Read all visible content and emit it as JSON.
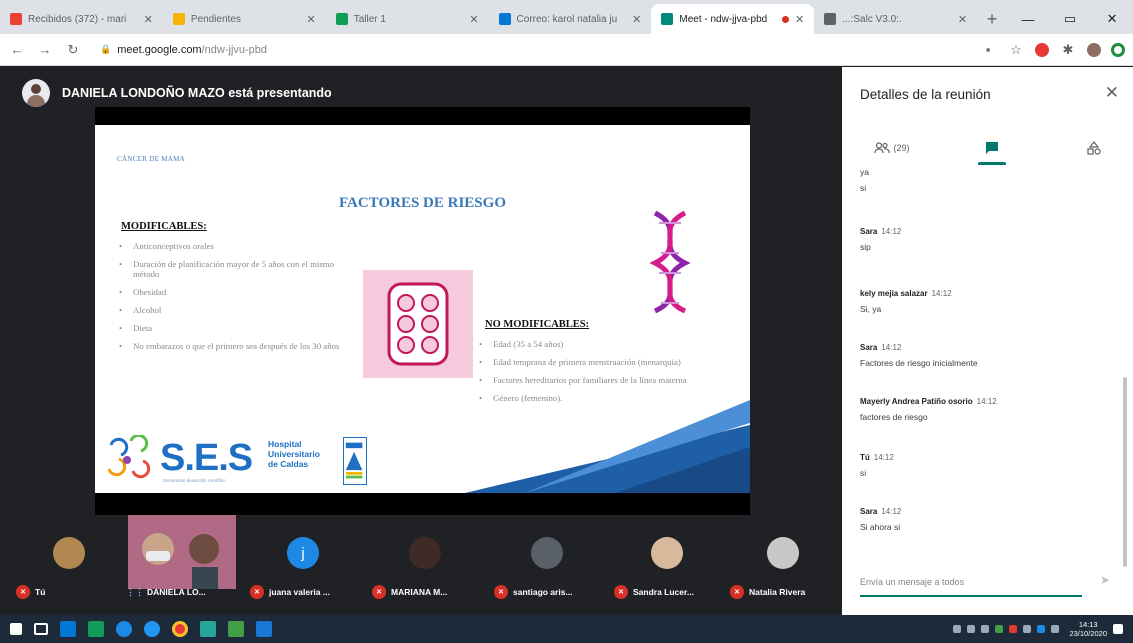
{
  "browser": {
    "tabs": [
      {
        "label": "Recibidos (372) - mari",
        "favicon_color": "#ea4335",
        "active": false
      },
      {
        "label": "Pendientes",
        "favicon_color": "#f4b400",
        "active": false
      },
      {
        "label": "Taller 1",
        "favicon_color": "#0f9d58",
        "active": false
      },
      {
        "label": "Correo: karol natalia ju",
        "favicon_color": "#0078d4",
        "active": false
      },
      {
        "label": "Meet - ndw-jjva-pbd",
        "favicon_color": "#00897b",
        "active": true
      },
      {
        "label": "...:Salc V3.0:.",
        "favicon_color": "#5f6368",
        "active": false
      }
    ],
    "new_tab": "+",
    "url_host": "meet.google.com",
    "url_path": "/ndw-jjvu-pbd"
  },
  "presenter": {
    "text": "DANIELA LONDOÑO MAZO está presentando"
  },
  "slide": {
    "topic": "CÁNCER DE MAMA",
    "title": "FACTORES DE RIESGO",
    "modifiable_heading": "MODIFICABLES:",
    "modifiable_items": [
      "Anticonceptivos orales",
      "Duración de planificación mayor de 5 años con el mismo método",
      "Obesidad",
      "Alcohol",
      "Dieta",
      "No embarazos o que el primero sea después de los 30 años"
    ],
    "non_modifiable_heading": "NO MODIFICABLES:",
    "non_modifiable_items": [
      "Edad (35 a 54 años)",
      "Edad temprana de primera menstruación (menarquia)",
      "Factores hereditarios por familiares de la línea materna",
      "Género (femenino)."
    ],
    "logo": {
      "name": "S.E.S",
      "hospital_line1": "Hospital",
      "hospital_line2": "Universitario",
      "hospital_line3": "de Caldas",
      "tagline": "Generando desarrollo científico"
    }
  },
  "panel": {
    "title": "Detalles de la reunión",
    "people_count": "(29)",
    "messages": [
      {
        "name": "",
        "time": "",
        "lines": [
          "ya",
          "si"
        ]
      },
      {
        "name": "Sara",
        "time": "14:12",
        "lines": [
          "sip"
        ]
      },
      {
        "name": "kely mejia salazar",
        "time": "14:12",
        "lines": [
          "Si, ya"
        ]
      },
      {
        "name": "Sara",
        "time": "14:12",
        "lines": [
          "Factores de riesgo inicialmente"
        ]
      },
      {
        "name": "Mayerly Andrea Patiño osorio",
        "time": "14:12",
        "lines": [
          "factores de riesgo"
        ]
      },
      {
        "name": "Tú",
        "time": "14:12",
        "lines": [
          "si"
        ]
      },
      {
        "name": "Sara",
        "time": "14:12",
        "lines": [
          "Si ahora si"
        ]
      }
    ],
    "composer_placeholder": "Envía un mensaje a todos"
  },
  "participants": [
    {
      "name": "Tú",
      "avatar_color": "#b08850",
      "muted": true,
      "kind": "photo"
    },
    {
      "name": "DANIELA LO...",
      "avatar_color": "#a65b7a",
      "muted": false,
      "kind": "video"
    },
    {
      "name": "juana valeria ...",
      "avatar_color": "#1e88e5",
      "muted": true,
      "kind": "letter",
      "letter": "j"
    },
    {
      "name": "MARIANA M...",
      "avatar_color": "#3e2b25",
      "muted": true,
      "kind": "photo"
    },
    {
      "name": "santiago aris...",
      "avatar_color": "#5a6068",
      "muted": true,
      "kind": "photo"
    },
    {
      "name": "Sandra Lucer...",
      "avatar_color": "#d9b99b",
      "muted": true,
      "kind": "photo"
    },
    {
      "name": "Natalia Rivera",
      "avatar_color": "#c8c8c8",
      "muted": true,
      "kind": "photo"
    }
  ],
  "taskbar": {
    "time": "14:13",
    "date": "23/10/2020"
  },
  "colors": {
    "accent_teal": "#00796b",
    "slide_title_blue": "#3a78b8",
    "muted_red": "#d93025"
  }
}
